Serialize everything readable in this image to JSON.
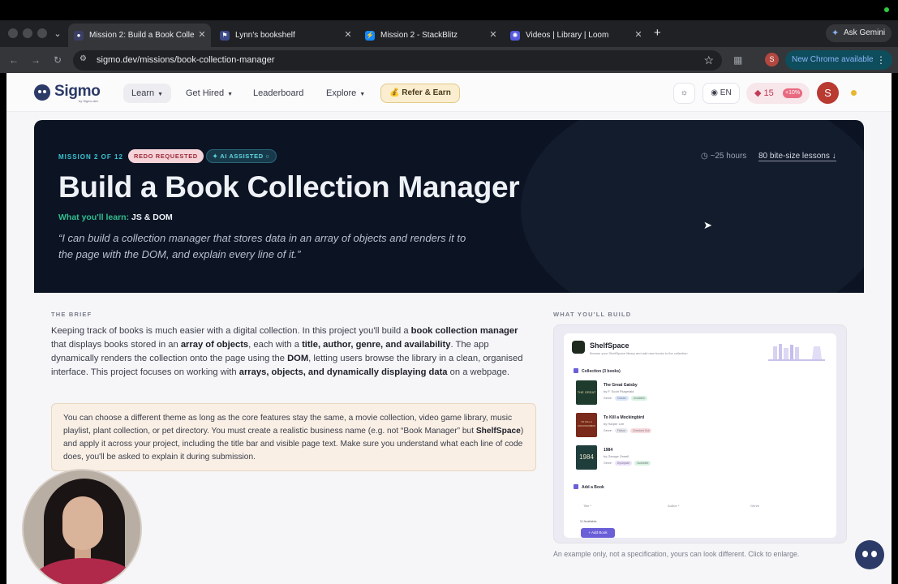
{
  "browser": {
    "tabs": [
      {
        "title": "Mission 2: Build a Book Colle",
        "favicon": "sigmo-icon",
        "fav_color": "#3b3f66"
      },
      {
        "title": "Lynn's bookshelf",
        "favicon": "flag-icon",
        "fav_color": "#3c4a8a"
      },
      {
        "title": "Mission 2 - StackBlitz",
        "favicon": "bolt-icon",
        "fav_color": "#1389fd"
      },
      {
        "title": "Videos | Library | Loom",
        "favicon": "loom-icon",
        "fav_color": "#565add"
      }
    ],
    "ask_gemini": "Ask Gemini",
    "url": "sigmo.dev/missions/book-collection-manager",
    "profile_initial": "S",
    "new_chrome": "New Chrome available"
  },
  "site": {
    "logo_name": "Sigmo",
    "logo_sub": "by Sigmo.dev",
    "nav": [
      {
        "label": "Learn",
        "chevron": true
      },
      {
        "label": "Get Hired",
        "chevron": true
      },
      {
        "label": "Leaderboard",
        "chevron": false
      },
      {
        "label": "Explore",
        "chevron": true
      }
    ],
    "refer": "Refer & Earn",
    "language": "EN",
    "streak_count": "15",
    "streak_bonus": "+10%",
    "avatar_initial": "S"
  },
  "hero": {
    "mission": "MISSION 2 OF 12",
    "redo_badge": "REDO REQUESTED",
    "ai_badge": "AI ASSISTED",
    "hours": "~25 hours",
    "lessons": "80 bite-size lessons",
    "title": "Build a Book Collection Manager",
    "learn_label": "What you'll learn:",
    "learn_value": "JS & DOM",
    "quote": "“I can build a collection manager that stores data in an array of objects and renders it to the page with the DOM, and explain every line of it.”"
  },
  "brief": {
    "label": "THE BRIEF",
    "p1": "Keeping track of books is much easier with a digital collection. In this project you'll build a",
    "p1_b1": "book collection manager",
    "p2": "that displays books stored in an",
    "p2_b": "array of objects",
    "p3": ", each with a",
    "p3_b": "title, author, genre, and availability",
    "p4": ". The app dynamically renders the collection onto the page using the",
    "p4_b": "DOM",
    "p5": ", letting users browse the library in a clean, organised interface. This project focuses on working with",
    "p5_b": "arrays, objects, and dynamically displaying data",
    "p6": "on a webpage.",
    "note_1": "You can choose a different theme as long as the core features stay the same, a movie collection, video game library, music playlist, plant collection, or pet directory. You must create a realistic business name (e.g. not “Book Manager” but",
    "note_b": "ShelfSpace",
    "note_2": ") and apply it across your project, including the title bar and visible page text. Make sure you understand what each line of code does, you'll be asked to explain it during submission."
  },
  "build": {
    "label": "WHAT YOU'LL BUILD",
    "app_name": "ShelfSpace",
    "app_sub": "Browse your ShelfSpace library and add new books to the collection",
    "collection_label": "Collection (3 books)",
    "books": [
      {
        "title": "The Great Gatsby",
        "author": "by F. Scott Fitzgerald",
        "genre_label": "Genre:",
        "genre": "Classic",
        "status": "Available",
        "cover_text": "THE GREAT GATSBY",
        "cover_color": "#1e3b2e",
        "genre_color": "#dbe7fb",
        "status_color": "#d8f3e1"
      },
      {
        "title": "To Kill a Mockingbird",
        "author": "by Harper Lee",
        "genre_label": "Genre:",
        "genre": "Fiction",
        "status": "Checked Out",
        "cover_text": "TO KILL A MOCKINGBIRD",
        "cover_color": "#7a2a1a",
        "genre_color": "#e8e8ee",
        "status_color": "#fadadd"
      },
      {
        "title": "1984",
        "author": "by George Orwell",
        "genre_label": "Genre:",
        "genre": "Dystopian",
        "status": "Available",
        "cover_text": "1984",
        "cover_color": "#1f3d3a",
        "genre_color": "#ece2fb",
        "status_color": "#d8f3e1"
      }
    ],
    "add_label": "Add a Book",
    "field_title": "Title *",
    "field_author": "Author *",
    "field_genre": "Genre",
    "available_label": "Available",
    "add_button": "+ Add Book",
    "caption": "An example only, not a specification, yours can look different. Click to enlarge."
  }
}
